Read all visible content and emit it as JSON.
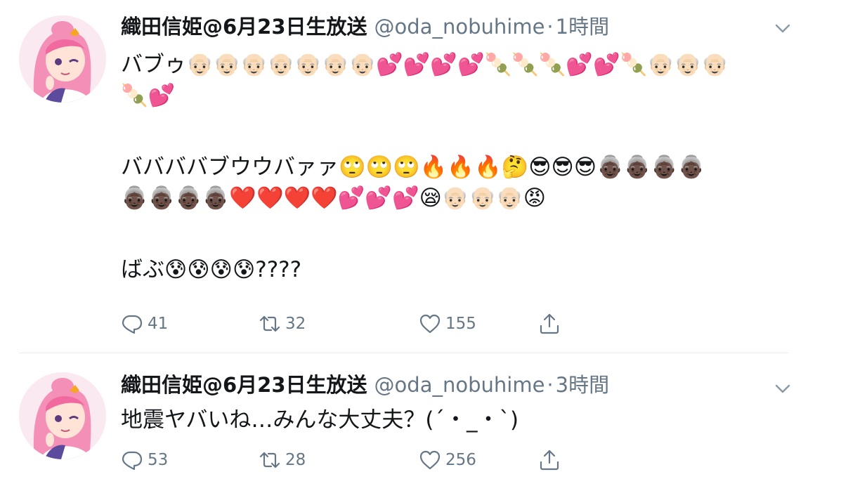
{
  "tweets": [
    {
      "display_name": "織田信姫@6月23日生放送",
      "handle": "@oda_nobuhime",
      "separator": "·",
      "time": "1時間",
      "lines": [
        "バブゥ👴🏻👴🏻👴🏻👴🏻👴🏻👴🏻👴🏻💕💕💕💕🍡🍡🍡💕💕🍡👴🏻👴🏻👴🏻",
        "🍡💕",
        "",
        "ババババブウウバァァ🙄🙄🙄🔥🔥🔥🤔😎😎😎👵🏿👵🏿👵🏿👵🏿",
        "👵🏿👵🏿👵🏿👵🏿❤️❤️❤️❤️💕💕💕😪👴🏻👴🏻👴🏻😡",
        "",
        "ばぶ😰😰😰😰????"
      ],
      "replies": "41",
      "retweets": "32",
      "likes": "155"
    },
    {
      "display_name": "織田信姫@6月23日生放送",
      "handle": "@oda_nobuhime",
      "separator": "·",
      "time": "3時間",
      "lines": [
        "地震ヤバいね…みんな大丈夫？(´・_・`)"
      ],
      "replies": "53",
      "retweets": "28",
      "likes": "256"
    }
  ],
  "icons": {
    "reply": "reply-icon",
    "retweet": "retweet-icon",
    "like": "heart-icon",
    "share": "share-icon",
    "caret": "chevron-down-icon"
  },
  "colors": {
    "text": "#14171a",
    "secondary": "#657786",
    "divider": "#e6ecf0",
    "avatar_bg": "#fbe9f1",
    "avatar_hair": "#f48fb8"
  }
}
